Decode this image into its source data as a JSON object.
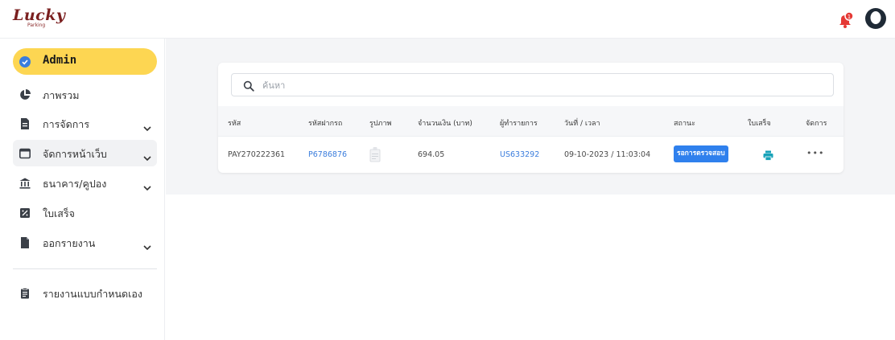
{
  "brand": {
    "logo_text": "Lucky",
    "logo_sub": "Parking"
  },
  "header": {
    "notification_count": "1"
  },
  "sidebar": {
    "items": [
      {
        "label": "Admin"
      },
      {
        "label": "ภาพรวม"
      },
      {
        "label": "การจัดการ"
      },
      {
        "label": "จัดการหน้าเว็บ"
      },
      {
        "label": "ธนาคาร/คูปอง"
      },
      {
        "label": "ใบเสร็จ"
      },
      {
        "label": "ออกรายงาน"
      },
      {
        "label": "รายงานแบบกำหนดเอง"
      }
    ]
  },
  "search": {
    "placeholder": "ค้นหา",
    "value": ""
  },
  "table": {
    "columns": [
      "รหัส",
      "รหัสฝากรถ",
      "รูปภาพ",
      "จำนวนเงิน (บาท)",
      "ผู้ทำรายการ",
      "วันที่ / เวลา",
      "สถานะ",
      "ใบเสร็จ",
      "จัดการ"
    ],
    "rows": [
      {
        "id": "PAY270222361",
        "parking_code": "P6786876",
        "amount": "694.05",
        "user": "US633292",
        "datetime": "09-10-2023 / 11:03:04",
        "status": "รอการตรวจสอบ",
        "actions": "•••"
      }
    ]
  },
  "colors": {
    "accent": "#fdd652",
    "link": "#3b7ddd",
    "status": "#2f80ed",
    "print": "#17a2b8",
    "notification": "#e53935"
  }
}
